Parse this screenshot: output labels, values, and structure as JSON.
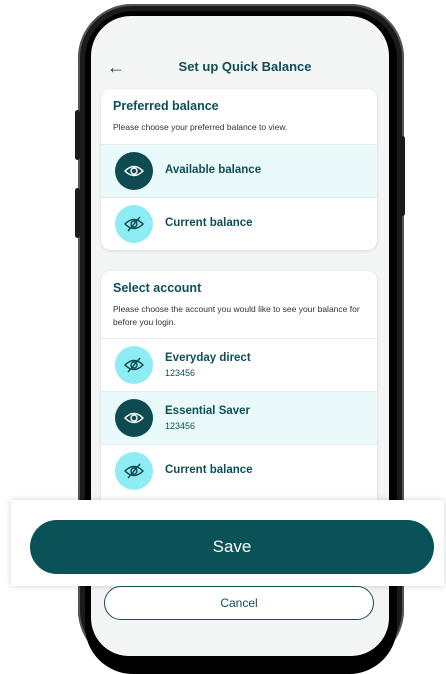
{
  "header": {
    "back_icon": "arrow-left-icon",
    "title": "Set up Quick Balance"
  },
  "preferred": {
    "title": "Preferred balance",
    "subtitle": "Please choose your preferred balance to view.",
    "options": [
      {
        "label": "Available balance",
        "icon": "eye-icon",
        "selected": true
      },
      {
        "label": "Current balance",
        "icon": "eye-off-icon",
        "selected": false
      }
    ]
  },
  "account": {
    "title": "Select account",
    "subtitle": "Please choose the account you would like to see your balance for before you login.",
    "items": [
      {
        "label": "Everyday direct",
        "number": "123456",
        "icon": "eye-off-icon",
        "selected": false
      },
      {
        "label": "Essential Saver",
        "number": "123456",
        "icon": "eye-icon",
        "selected": true
      },
      {
        "label": "Current balance",
        "icon": "eye-off-icon",
        "selected": false
      }
    ]
  },
  "actions": {
    "save_label": "Save",
    "cancel_label": "Cancel"
  },
  "colors": {
    "primary": "#0b5158",
    "selected_bg": "#eafafa",
    "icon_light": "#8eecf5"
  }
}
